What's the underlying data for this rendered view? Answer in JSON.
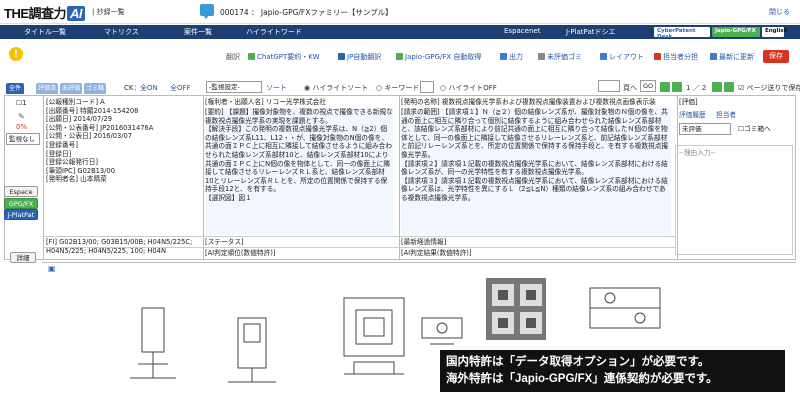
{
  "app": {
    "logo_text": "THE調査力",
    "logo_badge": "AI",
    "breadcrumb": "| 抄録一覧",
    "doc_title": "000174 ： Japio-GPG/FXファミリー【サンプル】",
    "close": "閉じる"
  },
  "nav": {
    "items": [
      "タイトル一覧",
      "マトリクス",
      "案件一覧",
      "ハイライトワード"
    ],
    "espacenet": "Espacenet",
    "jplatpat": "J-PlatPatドシエ",
    "brands": [
      "CyberPatent Desk",
      "Japio-GPG/FX",
      "English"
    ]
  },
  "toolbar": {
    "label": "翻訳",
    "items": [
      "ChatGPT要約・KW",
      "JP自動翻訳",
      "Japio-GPG/FX 自動取得",
      "出力",
      "未評価ゴミ",
      "レイアウト",
      "担当者分担",
      "最新に更新"
    ],
    "save": "保存"
  },
  "filters": {
    "tabs": [
      "全件",
      "評価済",
      "未評価",
      "ゴミ箱"
    ],
    "ck_label": "CK：",
    "all_on": "全ON",
    "all_off": "全OFF",
    "eval_select": "-監視設定-",
    "sort": "ソート",
    "radio": [
      "ハイライトソート",
      "キーワード",
      "ハイライトOFF"
    ],
    "page_label": "頁へ",
    "go": "GO",
    "pager": "1 ／ 2",
    "keep_page": "ページ送りで保存"
  },
  "left": {
    "checkbox_no": "1",
    "percent": "0%",
    "monitor": "監視なし",
    "buttons": [
      "Espace",
      "GPG/FX",
      "J-PlatPat",
      "詳細"
    ]
  },
  "biblio": [
    "[公報種別コード] A",
    "[出願番号] 特願2014-154208",
    "[出願日] 2014/07/29",
    "[公開・公表番号] JP2016031476A",
    "[公開・公表日] 2016/03/07",
    "[登録番号]",
    "[登録日]",
    "[登録公報発行日]",
    "[筆頭IPC] G02B13/00",
    "[発明者名] 山本晴菜"
  ],
  "applicant": "[権利者・出願人名] リコー光学株式会社",
  "summary": [
    "[要約] 【課題】撮像対象物を、複数の視点で撮像できる新規な複数視点撮像光学系の実現を課題とする。",
    "【解決手段】この発明の複数視点撮像光学系は、N（≧2）個の結像レンズ系L11、L12・・が、撮像対象物のN個の像を、共通の面ＩＰＣ上に相互に隣接して結像させるように組み合わせられた結像レンズ系部材10と、結像レンズ系部材10により共通の面ＩＰＣ上にN個の像を物体として、同一の像面上に隣接して結像させるリレーレンズＲＬ系と、結像レンズ系部材10とリレーレンズ系ＲＬとを、所定の位置関係で保持する保持手段12と、を有する。",
    "【選択図】図１"
  ],
  "invention": "[発明の名称] 複数視点撮像光学系および複数視点撮像装置および複数視点画像表示装",
  "claims": [
    "[請求の範囲] 【請求項１】Ｎ（≧２）個の結像レンズ系が、撮像対象物のＮ個の像を、共通の面上に相互に隣り合って個別に結像するように組み合わせられた結像レンズ系部材と、該結像レンズ系部材により前記共通の面上に相互に隣り合って結像したＮ個の像を物体として、同一の像面上に隣接して結像させるリレーレンズ系と、前記結像レンズ系部材と前記リレーレンズ系とを、所定の位置関係で保持する保持手段と、を有する複数視点撮像光学系。",
    "【請求項２】請求項１記載の複数視点撮像光学系において、結像レンズ系部材における結像レンズ系が、同一の光学特性を有する複数視点撮像光学系。",
    "【請求項３】請求項１記載の複数視点撮像光学系において、結像レンズ系部材における結像レンズ系は、光学特性を異にするＬ（2≦L≦N）種類の結像レンズ系の組み合わせである複数視点撮像光学系。"
  ],
  "fi": "[FI] G02B13/00; G03B15/00B; H04N5/225C; H04N5/225; H04N5/225, 100; H04N",
  "status": "[ステータス]",
  "ai_rank": "[AI判定順位(数値特許)]",
  "latest": "[最新経過情報]",
  "ai_result": "[AI判定結果(数値特許)]",
  "eval": {
    "title": "[評価]",
    "history": "評価履歴",
    "assignee": "担当者",
    "select": "未評価",
    "trash": "ゴミ箱へ",
    "memo": "--理由入力--"
  },
  "notice": [
    "国内特許は「データ取得オプション」が必要です。",
    "海外特許は「Japio-GPG/FX」連係契約が必要です。"
  ],
  "colors": {
    "nav": "#1e3f73",
    "accent": "#2b63b5",
    "save": "#d9331e",
    "green": "#4caf50"
  }
}
